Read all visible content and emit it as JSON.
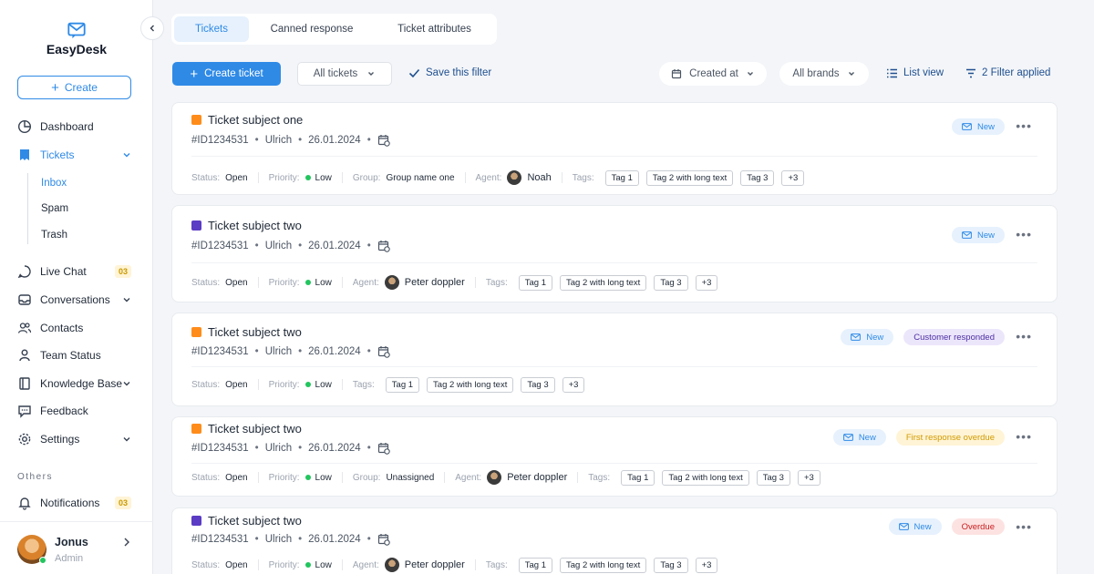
{
  "brand": {
    "name": "EasyDesk"
  },
  "sidebar": {
    "create_label": "Create",
    "nav": {
      "dashboard": "Dashboard",
      "tickets": "Tickets",
      "inbox": "Inbox",
      "spam": "Spam",
      "trash": "Trash",
      "live_chat": "Live Chat",
      "live_chat_count": "03",
      "conversations": "Conversations",
      "contacts": "Contacts",
      "team_status": "Team Status",
      "knowledge_base": "Knowledge Base",
      "feedback": "Feedback",
      "settings": "Settings",
      "section_others": "Others",
      "notifications": "Notifications",
      "notifications_count": "03"
    },
    "user": {
      "name": "Jonus",
      "role": "Admin"
    }
  },
  "tabs": [
    "Tickets",
    "Canned response",
    "Ticket attributes"
  ],
  "toolbar": {
    "create_ticket": "Create ticket",
    "all_tickets": "All tickets",
    "save_filter": "Save this filter",
    "created_at": "Created at",
    "all_brands": "All brands",
    "list_view": "List view",
    "filter_applied": "2 Filter applied"
  },
  "labels": {
    "status": "Status:",
    "priority": "Priority:",
    "group": "Group:",
    "agent": "Agent:",
    "tags": "Tags:"
  },
  "colors": {
    "accent": "#2f8ae6",
    "orange": "#ff8c1a",
    "purple": "#5b3cc4"
  },
  "tickets": [
    {
      "title": "Ticket subject one",
      "id": "#ID1234531",
      "user": "Ulrich",
      "date": "26.01.2024",
      "status": "Open",
      "priority": "Low",
      "group": "Group name one",
      "agent": "Noah",
      "tags": [
        "Tag 1",
        "Tag 2 with long text",
        "Tag 3"
      ],
      "more_tags": "+3",
      "new_label": "New",
      "extra_badge": ""
    },
    {
      "title": "Ticket subject two",
      "id": "#ID1234531",
      "user": "Ulrich",
      "date": "26.01.2024",
      "status": "Open",
      "priority": "Low",
      "agent": "Peter doppler",
      "tags": [
        "Tag 1",
        "Tag 2 with long text",
        "Tag 3"
      ],
      "more_tags": "+3",
      "new_label": "New",
      "extra_badge": ""
    },
    {
      "title": "Ticket subject two",
      "id": "#ID1234531",
      "user": "Ulrich",
      "date": "26.01.2024",
      "status": "Open",
      "priority": "Low",
      "tags": [
        "Tag 1",
        "Tag 2 with long text",
        "Tag 3"
      ],
      "more_tags": "+3",
      "new_label": "New",
      "extra_badge": "Customer responded"
    },
    {
      "title": "Ticket subject two",
      "id": "#ID1234531",
      "user": "Ulrich",
      "date": "26.01.2024",
      "status": "Open",
      "priority": "Low",
      "group": "Unassigned",
      "agent": "Peter doppler",
      "tags": [
        "Tag 1",
        "Tag 2 with long text",
        "Tag 3"
      ],
      "more_tags": "+3",
      "new_label": "New",
      "extra_badge": "First response overdue"
    },
    {
      "title": "Ticket subject two",
      "id": "#ID1234531",
      "user": "Ulrich",
      "date": "26.01.2024",
      "status": "Open",
      "priority": "Low",
      "agent": "Peter doppler",
      "tags": [
        "Tag 1",
        "Tag 2 with long text",
        "Tag 3"
      ],
      "more_tags": "+3",
      "new_label": "New",
      "extra_badge": "Overdue"
    }
  ]
}
